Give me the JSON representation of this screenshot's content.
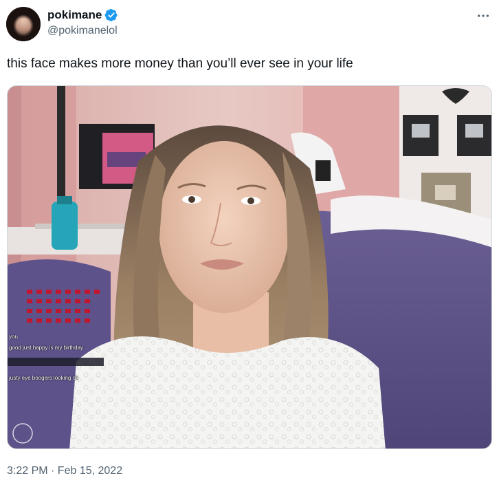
{
  "tweet": {
    "author": {
      "display_name": "pokimane",
      "handle": "@pokimanelol",
      "verified": true
    },
    "text": "this face makes more money than you’ll ever see in your life",
    "timestamp": "3:22 PM · Feb 15, 2022",
    "media": {
      "stream_chat_lines": [
        "you",
        "good just happy is my birthday",
        "justy eye boogers looking ok"
      ]
    }
  },
  "colors": {
    "text_primary": "#0f1419",
    "text_secondary": "#536471",
    "verified_blue": "#1d9bf0",
    "border": "#cfd9de"
  },
  "icons": {
    "verified": "verified-badge-icon",
    "more": "more-dots-icon"
  }
}
